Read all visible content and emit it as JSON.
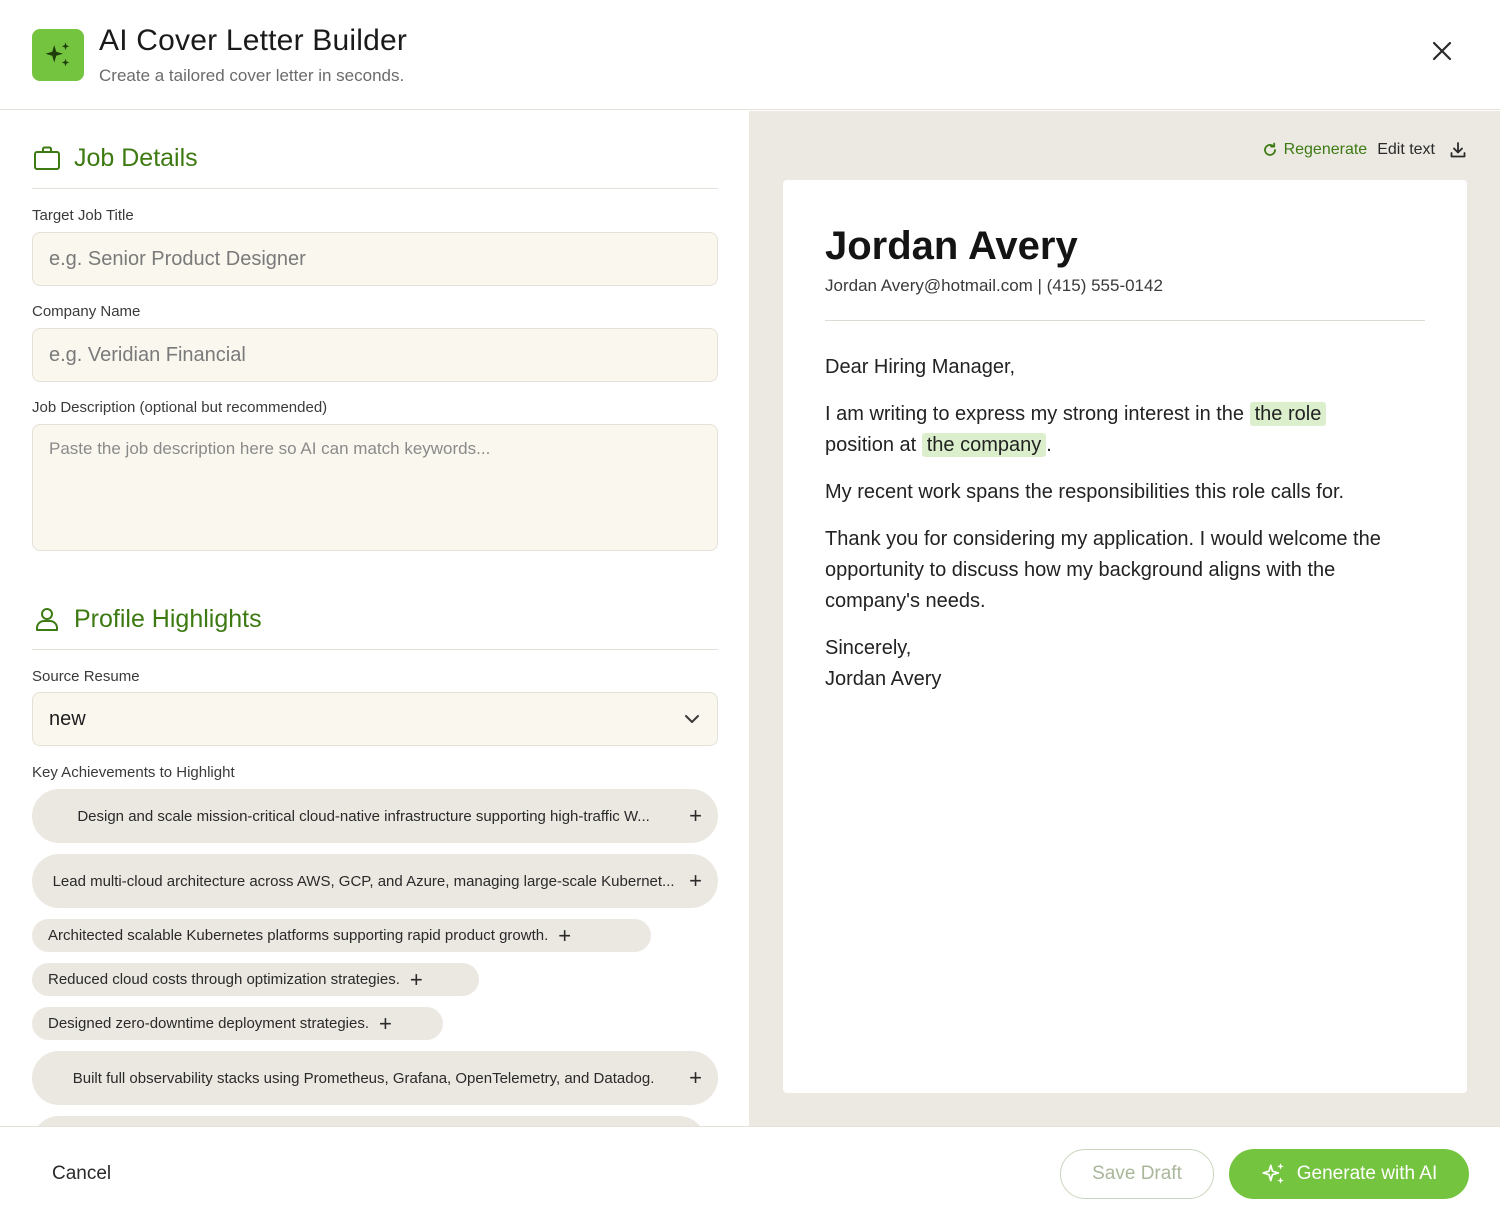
{
  "header": {
    "title": "AI Cover Letter Builder",
    "subtitle": "Create a tailored cover letter in seconds."
  },
  "job_details": {
    "section_title": "Job Details",
    "job_title_label": "Target Job Title",
    "job_title_placeholder": "e.g. Senior Product Designer",
    "company_label": "Company Name",
    "company_placeholder": "e.g. Veridian Financial",
    "description_label": "Job Description (optional but recommended)",
    "description_placeholder": "Paste the job description here so AI can match keywords..."
  },
  "profile": {
    "section_title": "Profile Highlights",
    "resume_label": "Source Resume",
    "resume_value": "new",
    "achievements_label": "Key Achievements to Highlight",
    "achievements": [
      "Design and scale mission-critical cloud-native infrastructure supporting high-traffic W...",
      "Lead multi-cloud architecture across AWS, GCP, and Azure, managing large-scale Kubernet...",
      "Architected scalable Kubernetes platforms supporting rapid product growth.",
      "Reduced cloud costs through optimization strategies.",
      "Designed zero-downtime deployment strategies.",
      "Built full observability stacks using Prometheus, Grafana, OpenTelemetry, and Datadog."
    ]
  },
  "preview": {
    "regenerate_label": "Regenerate",
    "edit_label": "Edit text",
    "name": "Jordan Avery",
    "contact": "Jordan Avery@hotmail.com | (415) 555-0142",
    "greeting": "Dear Hiring Manager,",
    "p1_before": "I am writing to express my strong interest in the ",
    "p1_role": "the role",
    "p1_mid": " position at ",
    "p1_company": "the company",
    "p1_after": ".",
    "p2": "My recent work spans the responsibilities this role calls for.",
    "p3": "Thank you for considering my application. I would welcome the opportunity to discuss how my background aligns with the company's needs.",
    "closing": "Sincerely,",
    "signature": "Jordan Avery"
  },
  "footer": {
    "cancel_label": "Cancel",
    "save_label": "Save Draft",
    "generate_label": "Generate with AI"
  },
  "colors": {
    "accent": "#74c43f",
    "accent_dark": "#3d7a12",
    "input_bg": "#faf7ef",
    "preview_bg": "#ebe9e2",
    "highlight": "#dcefcc"
  },
  "icons": {
    "app": "sparkles-icon",
    "close": "close-icon",
    "job": "briefcase-icon",
    "profile": "user-icon",
    "dropdown": "chevron-down-icon",
    "add": "plus-icon",
    "regenerate": "refresh-icon",
    "download": "download-icon"
  }
}
